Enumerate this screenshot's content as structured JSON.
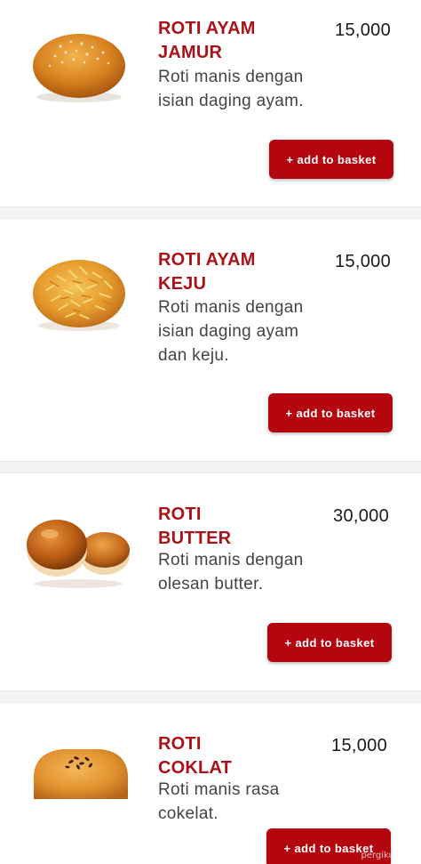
{
  "menu": {
    "items": [
      {
        "name": "ROTI AYAM\nJAMUR",
        "price": "15,000",
        "description": "Roti manis dengan isian daging ayam.",
        "button_label": "add to basket",
        "image_icon": "bread-jamur-icon"
      },
      {
        "name": "ROTI AYAM\nKEJU",
        "price": "15,000",
        "description": "Roti manis dengan isian daging ayam dan keju.",
        "button_label": "add to basket",
        "image_icon": "bread-keju-icon"
      },
      {
        "name": "ROTI\nBUTTER",
        "price": "30,000",
        "description": "Roti manis dengan olesan butter.",
        "button_label": "add to basket",
        "image_icon": "bread-butter-icon"
      },
      {
        "name": "ROTI\nCOKLAT",
        "price": "15,000",
        "description": "Roti manis rasa cokelat.",
        "button_label": "add to basket",
        "image_icon": "bread-coklat-icon"
      }
    ],
    "button_icon": "+",
    "watermark": "pergikuliner"
  },
  "colors": {
    "brand_red": "#a8131a",
    "button_red": "#b4060f"
  }
}
